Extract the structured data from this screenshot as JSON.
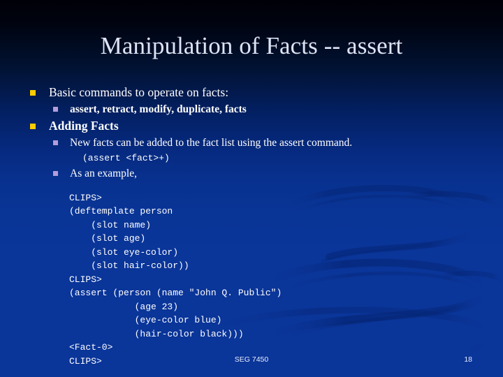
{
  "slide": {
    "title": "Manipulation of Facts -- assert",
    "background": {
      "top_color": "#000007",
      "mid_color": "#032063",
      "bottom_color": "#0a3599",
      "ribbon_color": "#062a86"
    },
    "bullet_colors": {
      "level1": "#ffcc00",
      "level2": "#b39ddb"
    },
    "text_color": "#ffffff",
    "title_color": "#dde4f5"
  },
  "content": [
    {
      "level": 1,
      "bullet": "square-bullet-gold",
      "bold": false,
      "text": "Basic commands to operate on facts:"
    },
    {
      "level": 2,
      "bullet": "square-bullet-lavender",
      "bold": true,
      "text": "assert, retract, modify, duplicate, facts"
    },
    {
      "level": 1,
      "bullet": "square-bullet-gold",
      "bold": true,
      "text": "Adding Facts"
    },
    {
      "level": 2,
      "bullet": "square-bullet-lavender",
      "bold": false,
      "text": "New facts can be added to the fact list using the assert command."
    },
    {
      "level": "code-inline",
      "bullet": null,
      "bold": false,
      "text": "(assert <fact>+)"
    },
    {
      "level": 2,
      "bullet": "square-bullet-lavender",
      "bold": false,
      "text": "As an example,"
    }
  ],
  "code_block": {
    "lines": [
      "CLIPS>",
      "(deftemplate person",
      "    (slot name)",
      "    (slot age)",
      "    (slot eye-color)",
      "    (slot hair-color))",
      "CLIPS>",
      "(assert (person (name \"John Q. Public\")",
      "            (age 23)",
      "            (eye-color blue)",
      "            (hair-color black)))",
      "<Fact-0>",
      "CLIPS>"
    ]
  },
  "footer": {
    "course": "SEG 7450",
    "page_number": "18"
  }
}
